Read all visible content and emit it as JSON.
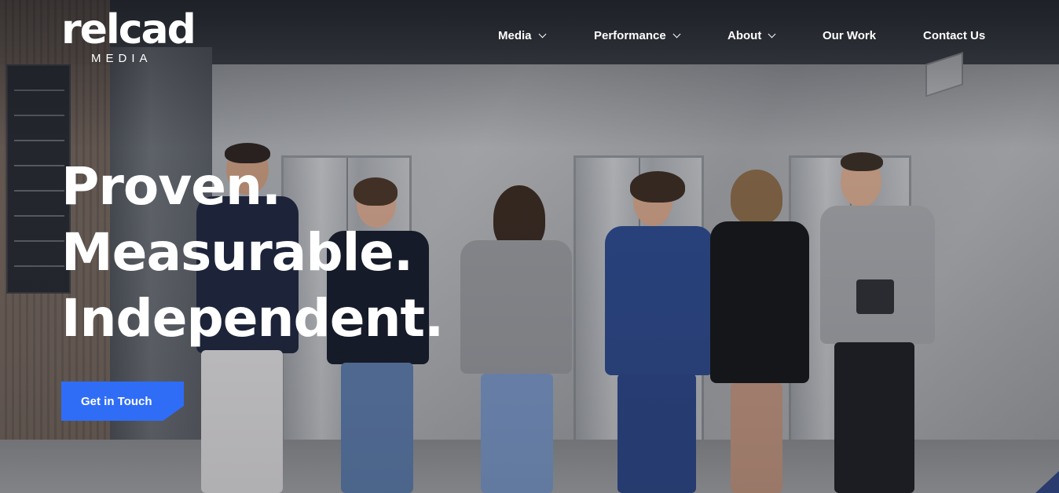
{
  "brand": {
    "logo_word": "relcad",
    "logo_sub": "MEDIA"
  },
  "nav": {
    "items": [
      {
        "label": "Media",
        "has_dropdown": true
      },
      {
        "label": "Performance",
        "has_dropdown": true
      },
      {
        "label": "About",
        "has_dropdown": true
      },
      {
        "label": "Our Work",
        "has_dropdown": false
      },
      {
        "label": "Contact Us",
        "has_dropdown": false
      }
    ]
  },
  "hero": {
    "headline_lines": [
      "Proven.",
      "Measurable.",
      "Independent."
    ],
    "cta_label": "Get in Touch"
  },
  "colors": {
    "accent": "#2f6df6",
    "text": "#ffffff"
  },
  "icons": {
    "dropdown": "chevron-down-icon"
  }
}
